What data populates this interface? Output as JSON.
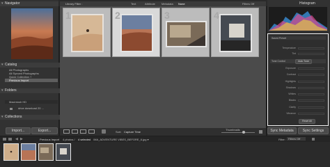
{
  "left_panel": {
    "navigator_title": "Navigator",
    "navigator_modes": [
      "FIT",
      "FILL",
      "1:1",
      "3:1"
    ],
    "catalog_title": "Catalog",
    "catalog_items": [
      "All Photographs",
      "All Synced Photographs",
      "Quick Collection +",
      "Previous Import"
    ],
    "folders_title": "Folders",
    "volume_name": "Macintosh HD",
    "folder_name": "drive download 20 ...",
    "collections_title": "Collections",
    "import_label": "Import...",
    "export_label": "Export..."
  },
  "center": {
    "library_filter_label": "Library Filter :",
    "filter_tabs": [
      "Text",
      "Attribute",
      "Metadata",
      "None"
    ],
    "filters_off": "Filters Off",
    "cell_numbers": [
      "1",
      "2",
      "3",
      "4"
    ],
    "sort_label": "Sort:",
    "sort_value": "Capture Time",
    "thumbnails_label": "Thumbnails"
  },
  "right_panel": {
    "histogram_title": "Histogram",
    "histogram_colors": [
      "#3a8fd8",
      "#d84a8c",
      "#e0c24a",
      "#ffffff"
    ],
    "top_row_label": "Saved Preset",
    "sliders_top": [
      "Temperature",
      "Tint"
    ],
    "tone_control_label": "Tone Control",
    "auto_tone_label": "Auto Tone",
    "sliders_tone": [
      "Exposure",
      "Contrast",
      "Highlights",
      "Shadows",
      "Whites",
      "Blacks",
      "Clarity",
      "Vibrance"
    ],
    "reset_all_label": "Reset All",
    "sync_metadata_label": "Sync Metadata",
    "sync_settings_label": "Sync Settings"
  },
  "filmstrip_bar": {
    "breadcrumb": "Previous Import",
    "count_text": "4 photos /",
    "selected_text": "4 selected",
    "filename_text": "/MA_ADVENTURE VIBES_BEFORE_6.jpg ▾",
    "filter_label": "Filter :",
    "filter_value": "Filters Off"
  }
}
